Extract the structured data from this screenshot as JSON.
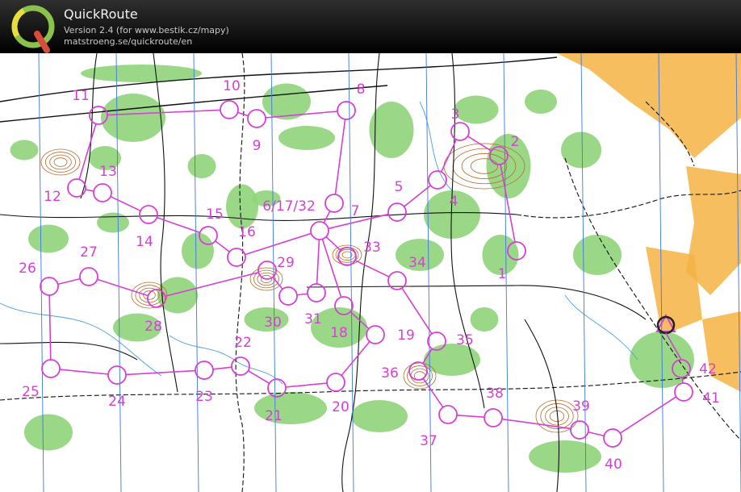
{
  "app": {
    "title": "QuickRoute",
    "version": "Version 2.4  (for www.bestik.cz/mapy)",
    "url": "matstroeng.se/quickroute/en",
    "logo_letter": "Q"
  },
  "colors": {
    "course": "#d63fd6",
    "forest": "#8fd47a",
    "open": "#f5b342",
    "contour": "#b86b2a",
    "water": "#4aa0e0",
    "path": "#111111",
    "magnetic_north": "#3a78e8"
  },
  "icons": [
    "q-logo-icon"
  ],
  "controls": [
    {
      "label": "1",
      "value": 1
    },
    {
      "label": "2",
      "value": 2
    },
    {
      "label": "3",
      "value": 3
    },
    {
      "label": "4",
      "value": 4
    },
    {
      "label": "5",
      "value": 5
    },
    {
      "label": "6/17/32",
      "value": 6
    },
    {
      "label": "7",
      "value": 7
    },
    {
      "label": "8",
      "value": 8
    },
    {
      "label": "9",
      "value": 9
    },
    {
      "label": "10",
      "value": 10
    },
    {
      "label": "11",
      "value": 11
    },
    {
      "label": "12",
      "value": 12
    },
    {
      "label": "13",
      "value": 13
    },
    {
      "label": "14",
      "value": 14
    },
    {
      "label": "15",
      "value": 15
    },
    {
      "label": "16",
      "value": 16
    },
    {
      "label": "18",
      "value": 18
    },
    {
      "label": "19",
      "value": 19
    },
    {
      "label": "20",
      "value": 20
    },
    {
      "label": "21",
      "value": 21
    },
    {
      "label": "22",
      "value": 22
    },
    {
      "label": "23",
      "value": 23
    },
    {
      "label": "24",
      "value": 24
    },
    {
      "label": "25",
      "value": 25
    },
    {
      "label": "26",
      "value": 26
    },
    {
      "label": "27",
      "value": 27
    },
    {
      "label": "28",
      "value": 28
    },
    {
      "label": "29",
      "value": 29
    },
    {
      "label": "30",
      "value": 30
    },
    {
      "label": "31",
      "value": 31
    },
    {
      "label": "33",
      "value": 33
    },
    {
      "label": "34",
      "value": 34
    },
    {
      "label": "35",
      "value": 35
    },
    {
      "label": "36",
      "value": 36
    },
    {
      "label": "37",
      "value": 37
    },
    {
      "label": "38",
      "value": 38
    },
    {
      "label": "39",
      "value": 39
    },
    {
      "label": "40",
      "value": 40
    },
    {
      "label": "41",
      "value": 41
    },
    {
      "label": "42",
      "value": 42
    }
  ]
}
